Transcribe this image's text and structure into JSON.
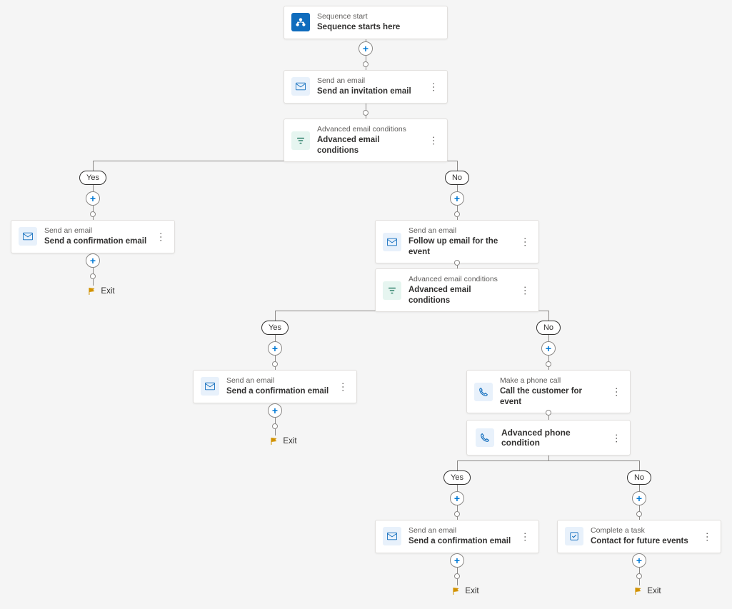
{
  "labels": {
    "yes": "Yes",
    "no": "No",
    "exit": "Exit"
  },
  "nodes": {
    "start": {
      "sub": "Sequence start",
      "title": "Sequence starts here"
    },
    "invite": {
      "sub": "Send an email",
      "title": "Send an invitation email"
    },
    "cond1": {
      "sub": "Advanced email conditions",
      "title": "Advanced email conditions"
    },
    "confirm1": {
      "sub": "Send an email",
      "title": "Send a confirmation email"
    },
    "followup": {
      "sub": "Send an email",
      "title": "Follow up email for the event"
    },
    "cond2": {
      "sub": "Advanced email conditions",
      "title": "Advanced email conditions"
    },
    "confirm2": {
      "sub": "Send an email",
      "title": "Send a confirmation email"
    },
    "call": {
      "sub": "Make a phone call",
      "title": "Call the customer for event"
    },
    "phonecond": {
      "title": "Advanced phone condition"
    },
    "confirm3": {
      "sub": "Send an email",
      "title": "Send a confirmation email"
    },
    "task": {
      "sub": "Complete a task",
      "title": "Contact for future events"
    }
  }
}
